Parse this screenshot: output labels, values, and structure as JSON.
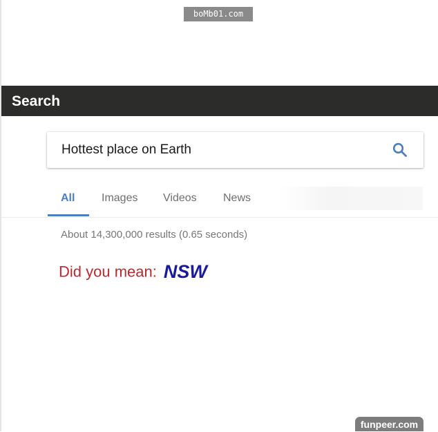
{
  "watermark_top": "boMb01.com",
  "header": {
    "title": "Search"
  },
  "search": {
    "query": "Hottest place on Earth",
    "icon": "magnifier"
  },
  "tabs": [
    {
      "label": "All",
      "active": true
    },
    {
      "label": "Images",
      "active": false
    },
    {
      "label": "Videos",
      "active": false
    },
    {
      "label": "News",
      "active": false
    }
  ],
  "results": {
    "stats": "About 14,300,000 results (0.65 seconds)"
  },
  "suggestion": {
    "label": "Did you mean:",
    "link": "NSW"
  },
  "watermark_bottom": "funpeer.com",
  "colors": {
    "header_bg": "#2c2c2a",
    "accent": "#4a7fc0",
    "suggestion_label": "#c0272d",
    "suggestion_link": "#1a1a9e"
  }
}
